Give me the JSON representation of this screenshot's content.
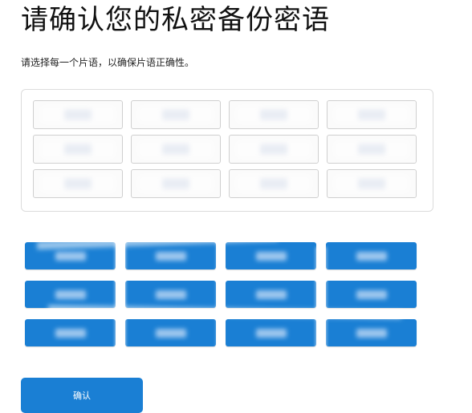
{
  "page": {
    "title": "请确认您的私密备份密语",
    "instruction": "请选择每一个片语，以确保片语正确性。"
  },
  "selected_slots": {
    "count": 12,
    "words": [
      "",
      "",
      "",
      "",
      "",
      "",
      "",
      "",
      "",
      "",
      "",
      ""
    ]
  },
  "phrase_buttons": {
    "count": 12,
    "words": [
      "",
      "",
      "",
      "",
      "",
      "",
      "",
      "",
      "",
      "",
      "",
      ""
    ]
  },
  "confirm_button": {
    "label": "确认"
  },
  "colors": {
    "accent": "#1a7fd4",
    "slot_border": "#cfcfcf",
    "box_border": "#dcdcdc"
  }
}
